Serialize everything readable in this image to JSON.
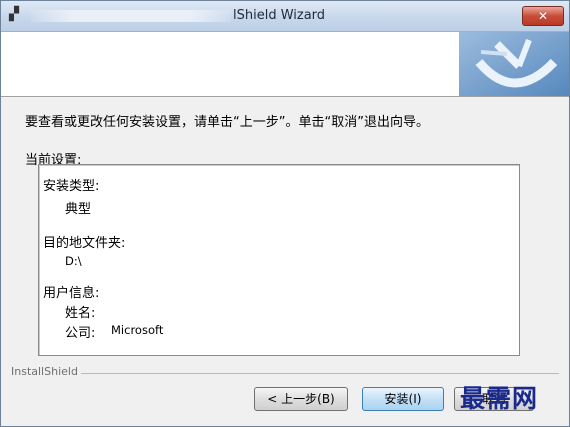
{
  "window": {
    "title": "lShield Wizard",
    "close_glyph": "✕"
  },
  "instruction": "要查看或更改任何安装设置，请单击“上一步”。单击“取消”退出向导。",
  "current_settings": {
    "label": "当前设置:",
    "install_type_label": "安装类型:",
    "install_type_value": "典型",
    "dest_folder_label": "目的地文件夹:",
    "dest_folder_value": "D:\\",
    "user_info_label": "用户信息:",
    "name_label": "姓名:",
    "company_label": "公司:",
    "company_value": "Microsoft"
  },
  "installshield_label": "InstallShield",
  "buttons": {
    "back": "< 上一步(B)",
    "install": "安装(I)",
    "cancel": "取消"
  },
  "watermark": "最需网",
  "colors": {
    "titlebar": "#c9d9ec",
    "close_button": "#c84d38",
    "logo_blue": "#2f6aa8"
  }
}
